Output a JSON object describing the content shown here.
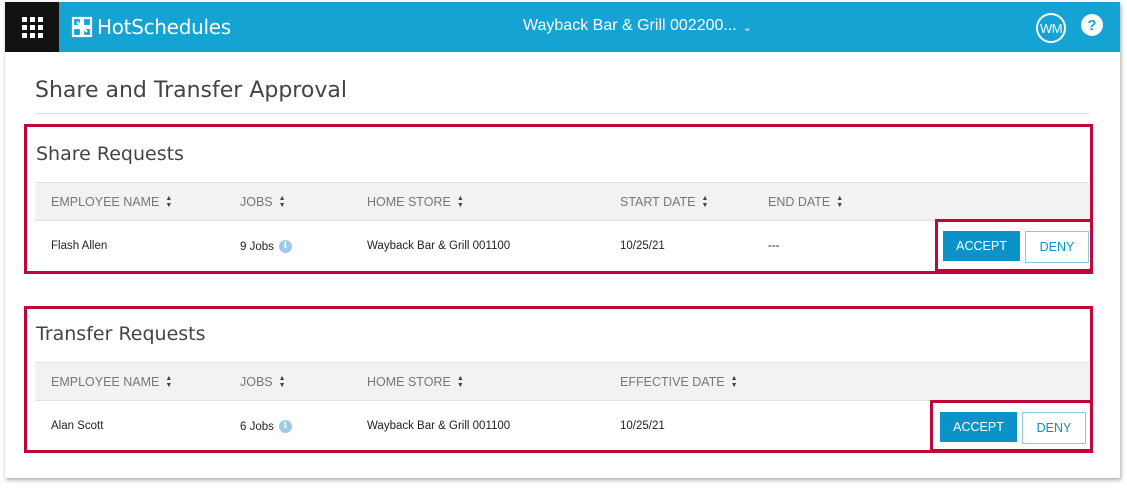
{
  "header": {
    "brand": "HotSchedules",
    "store": "Wayback Bar & Grill 002200...",
    "avatar_initials": "WM",
    "help_label": "?",
    "accent_color": "#14a3d2"
  },
  "page": {
    "title": "Share and Transfer Approval"
  },
  "share": {
    "title": "Share Requests",
    "columns": [
      "EMPLOYEE NAME",
      "JOBS",
      "HOME STORE",
      "START DATE",
      "END DATE"
    ],
    "rows": [
      {
        "employee": "Flash Allen",
        "jobs": "9 Jobs",
        "home_store": "Wayback Bar & Grill 001100",
        "start_date": "10/25/21",
        "end_date": "---",
        "accept": "ACCEPT",
        "deny": "DENY"
      }
    ]
  },
  "transfer": {
    "title": "Transfer Requests",
    "columns": [
      "EMPLOYEE NAME",
      "JOBS",
      "HOME STORE",
      "EFFECTIVE DATE"
    ],
    "rows": [
      {
        "employee": "Alan Scott",
        "jobs": "6 Jobs",
        "home_store": "Wayback Bar & Grill 001100",
        "effective_date": "10/25/21",
        "accept": "ACCEPT",
        "deny": "DENY"
      }
    ]
  },
  "icons": {
    "info": "i",
    "sort_up": "▲",
    "sort_down": "▼",
    "chevron": "⌄"
  }
}
